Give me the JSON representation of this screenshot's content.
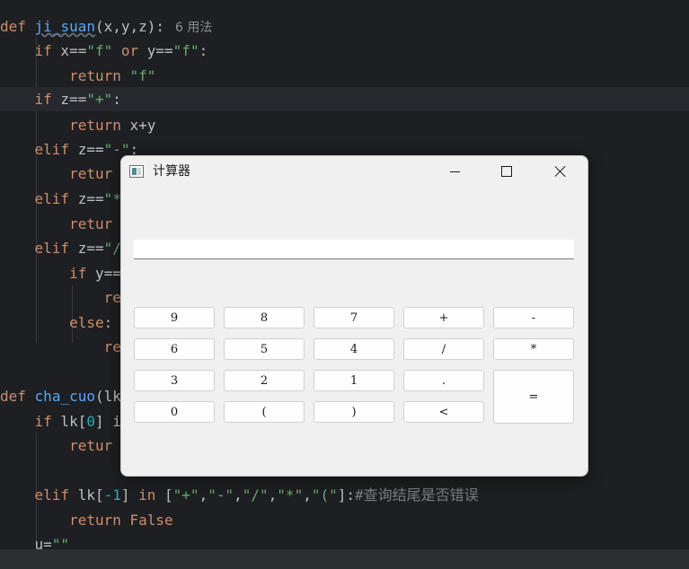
{
  "editor": {
    "function_def": {
      "keyword": "def",
      "name": "ji_suan",
      "params": "(x,y,z):",
      "usage_hint": "6 用法"
    },
    "line_if_f": {
      "kw": "if",
      "a": " x==",
      "s1": "\"f\"",
      "or": " or ",
      "b": "y==",
      "s2": "\"f\"",
      "end": ":"
    },
    "line_return_f": {
      "kw": "return ",
      "s": "\"f\""
    },
    "line_if_plus": {
      "kw": "if",
      "a": " z==",
      "s": "\"+\"",
      "end": ":"
    },
    "line_return_sum": {
      "kw": "return",
      "rest": " x+y"
    },
    "line_elif_minus": {
      "kw": "elif",
      "a": " z==",
      "s": "\"-\"",
      "end": ":"
    },
    "line_return_partial_1": {
      "kw": "retur"
    },
    "line_elif_mul": {
      "kw": "elif",
      "a": " z==",
      "s": "\"*"
    },
    "line_return_partial_2": {
      "kw": "retur"
    },
    "line_elif_div": {
      "kw": "elif",
      "a": " z==",
      "s": "\"/"
    },
    "line_if_y": {
      "kw": "if",
      "a": " y=="
    },
    "line_re_1": {
      "kw": "re"
    },
    "line_else": {
      "kw": "else",
      "end": ":"
    },
    "line_re_2": {
      "kw": "re"
    },
    "check_def": {
      "keyword": "def",
      "name": "cha_cuo",
      "params": "(lk"
    },
    "line_if_lk": {
      "kw": "if",
      "a": " lk[",
      "n": "0",
      "b": "] i"
    },
    "line_return_partial_3": {
      "kw": "retur"
    },
    "line_elif_lk": {
      "kw": "elif",
      "a": " lk[",
      "n": "-1",
      "b": "] ",
      "in": "in",
      "c": " [",
      "s1": "\"+\"",
      "c1": ",",
      "s2": "\"-\"",
      "c2": ",",
      "s3": "\"/\"",
      "c3": ",",
      "s4": "\"*\"",
      "c4": ",",
      "s5": "\"(\"",
      "c5": "]:",
      "comment": "#查询结尾是否错误"
    },
    "line_return_false": {
      "kw": "return",
      "rest": " ",
      "val": "False"
    },
    "line_u_assign": {
      "a": "u=",
      "s": "\"\""
    }
  },
  "window": {
    "title": "计算器",
    "display_value": ""
  },
  "keypad": {
    "row1": [
      "9",
      "8",
      "7",
      "+",
      "-"
    ],
    "row2": [
      "6",
      "5",
      "4",
      "/",
      "*"
    ],
    "row3": [
      "3",
      "2",
      "1",
      "."
    ],
    "row4": [
      "0",
      "(",
      ")",
      "<"
    ],
    "equals": "="
  }
}
